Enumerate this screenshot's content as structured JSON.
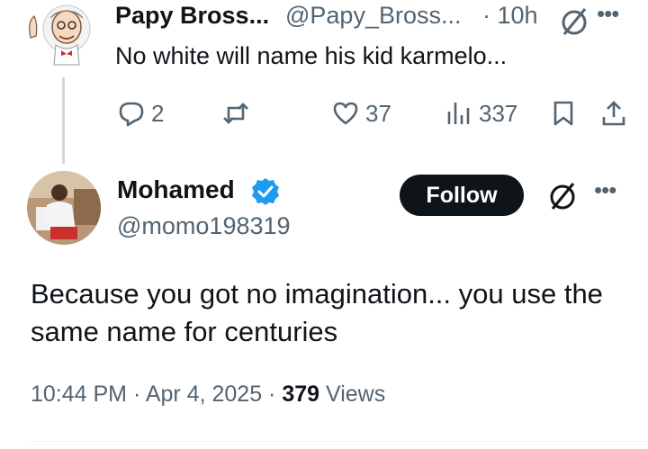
{
  "parent": {
    "author_name": "Papy Bross...",
    "handle": "@Papy_Bross...",
    "time": "· 10h",
    "text": "No white will name his kid karmelo...",
    "actions": {
      "replies": "2",
      "reposts": "",
      "likes": "37",
      "views": "337"
    },
    "icons": [
      "cartoon-avatar",
      "grok-icon",
      "more-icon",
      "reply-icon",
      "repost-icon",
      "like-icon",
      "views-icon",
      "bookmark-icon",
      "share-icon"
    ]
  },
  "reply": {
    "author_name": "Mohamed",
    "handle": "@momo198319",
    "follow_label": "Follow",
    "text": "Because you got no imagination... you use the same name for centuries",
    "timestamp": "10:44 PM · Apr 4, 2025 · ",
    "views_count": "379",
    "views_label": " Views",
    "icons": [
      "verified-badge-icon",
      "grok-icon",
      "more-icon"
    ]
  },
  "colors": {
    "text": "#0f1419",
    "secondary": "#536471",
    "verified": "#1d9bf0",
    "follow_bg": "#0f1419"
  }
}
